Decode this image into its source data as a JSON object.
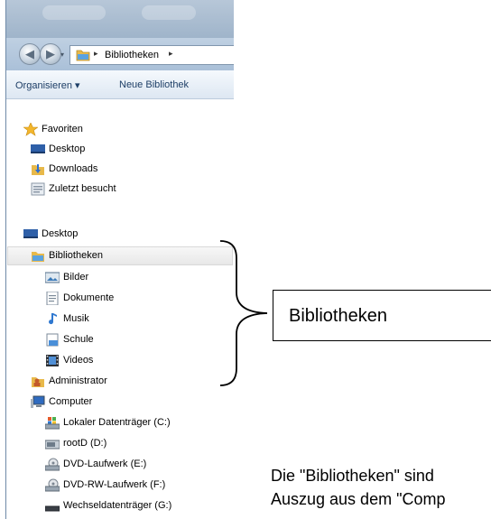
{
  "address_bar": {
    "separator": "▸",
    "current": "Bibliotheken",
    "trailing_separator": "▸"
  },
  "toolbar": {
    "organize": "Organisieren ▾",
    "new_library": "Neue Bibliothek"
  },
  "tree": {
    "favorites": {
      "label": "Favoriten",
      "items": [
        "Desktop",
        "Downloads",
        "Zuletzt besucht"
      ]
    },
    "desktop": "Desktop",
    "libraries": {
      "label": "Bibliotheken",
      "items": [
        "Bilder",
        "Dokumente",
        "Musik",
        "Schule",
        "Videos"
      ]
    },
    "administrator": "Administrator",
    "computer": {
      "label": "Computer",
      "items": [
        "Lokaler Datenträger (C:)",
        "rootD (D:)",
        "DVD-Laufwerk (E:)",
        "DVD-RW-Laufwerk (F:)",
        "Wechseldatenträger (G:)"
      ]
    }
  },
  "callout": {
    "label": "Bibliotheken"
  },
  "caption": {
    "line1": "Die \"Bibliotheken\" sind",
    "line2": "Auszug aus dem \"Comp"
  },
  "colors": {
    "title_bar": "#a9bdd2",
    "selection": "#ececec",
    "toolbar_text": "#1d3e66"
  }
}
